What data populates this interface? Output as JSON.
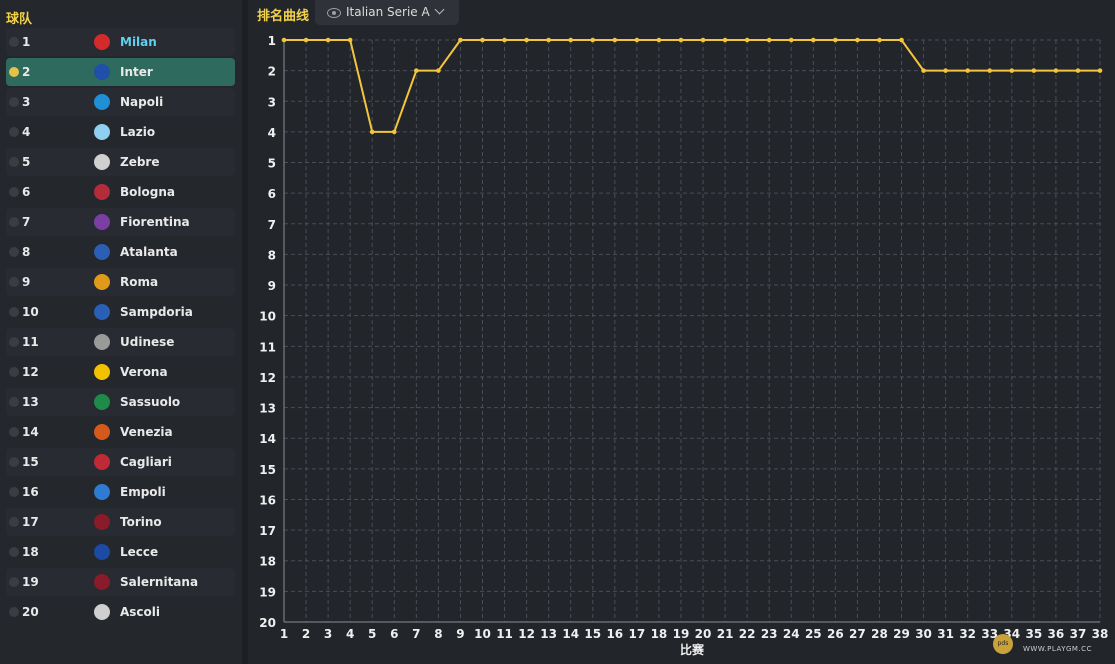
{
  "left_panel": {
    "header": "球队",
    "teams": [
      {
        "pos": "1",
        "name": "Milan",
        "crest_color": "#d32b2b",
        "highlight": true
      },
      {
        "pos": "2",
        "name": "Inter",
        "crest_color": "#1f4fa8",
        "selected": true
      },
      {
        "pos": "3",
        "name": "Napoli",
        "crest_color": "#1f8fd6"
      },
      {
        "pos": "4",
        "name": "Lazio",
        "crest_color": "#8fd0f0"
      },
      {
        "pos": "5",
        "name": "Zebre",
        "crest_color": "#d0d0d0"
      },
      {
        "pos": "6",
        "name": "Bologna",
        "crest_color": "#b22c3a"
      },
      {
        "pos": "7",
        "name": "Fiorentina",
        "crest_color": "#7b3fa3"
      },
      {
        "pos": "8",
        "name": "Atalanta",
        "crest_color": "#2a5fb5"
      },
      {
        "pos": "9",
        "name": "Roma",
        "crest_color": "#e09a1a"
      },
      {
        "pos": "10",
        "name": "Sampdoria",
        "crest_color": "#2a5fb5"
      },
      {
        "pos": "11",
        "name": "Udinese",
        "crest_color": "#9a9a9a"
      },
      {
        "pos": "12",
        "name": "Verona",
        "crest_color": "#f2c200"
      },
      {
        "pos": "13",
        "name": "Sassuolo",
        "crest_color": "#1e8b4a"
      },
      {
        "pos": "14",
        "name": "Venezia",
        "crest_color": "#d45a1c"
      },
      {
        "pos": "15",
        "name": "Cagliari",
        "crest_color": "#c02a36"
      },
      {
        "pos": "16",
        "name": "Empoli",
        "crest_color": "#2f7ad2"
      },
      {
        "pos": "17",
        "name": "Torino",
        "crest_color": "#8a1c2a"
      },
      {
        "pos": "18",
        "name": "Lecce",
        "crest_color": "#1d4aa3"
      },
      {
        "pos": "19",
        "name": "Salernitana",
        "crest_color": "#8a1c2a"
      },
      {
        "pos": "20",
        "name": "Ascoli",
        "crest_color": "#cfcfcf"
      }
    ]
  },
  "chart_header": {
    "title": "排名曲线",
    "league_select": "Italian Serie A"
  },
  "chart_data": {
    "type": "line",
    "title": "",
    "xlabel": "比赛",
    "ylabel": "",
    "x": [
      1,
      2,
      3,
      4,
      5,
      6,
      7,
      8,
      9,
      10,
      11,
      12,
      13,
      14,
      15,
      16,
      17,
      18,
      19,
      20,
      21,
      22,
      23,
      24,
      25,
      26,
      27,
      28,
      29,
      30,
      31,
      32,
      33,
      34,
      35,
      36,
      37,
      38
    ],
    "y": [
      1,
      1,
      1,
      1,
      4,
      4,
      2,
      2,
      1,
      1,
      1,
      1,
      1,
      1,
      1,
      1,
      1,
      1,
      1,
      1,
      1,
      1,
      1,
      1,
      1,
      1,
      1,
      1,
      1,
      2,
      2,
      2,
      2,
      2,
      2,
      2,
      2,
      2
    ],
    "ylim": [
      1,
      20
    ],
    "y_inverted": true,
    "grid": true,
    "line_color": "#f2c53d"
  },
  "watermark": {
    "logo": "pds",
    "text": "WWW.PLAYGM.CC"
  }
}
